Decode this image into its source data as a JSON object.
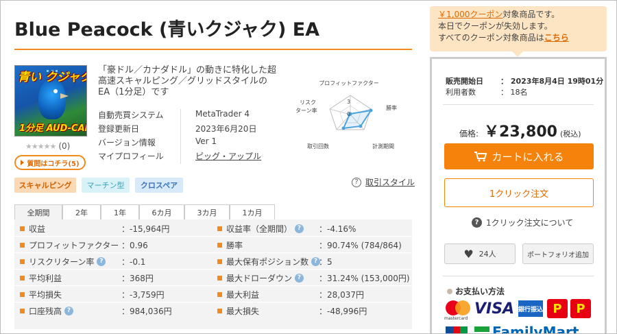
{
  "product": {
    "title": "Blue Peacock (青いクジャク) EA",
    "thumb_line1": "青い クジャク",
    "thumb_line2": "1分足  AUD-CAD",
    "stars": "★★★★★",
    "review_count": "(0)",
    "qa_label": "質問はコチラ(5)",
    "description": "「豪ドル／カナダドル」の動きに特化した超高速スキャルピング／グリッドスタイルのEA（1分足）です"
  },
  "specs": [
    {
      "key": "自動売買システム",
      "value": "MetaTrader 4"
    },
    {
      "key": "登録更新日",
      "value": "2023年6月20日"
    },
    {
      "key": "バージョン情報",
      "value": "Ver 1"
    },
    {
      "key": "マイプロフィール",
      "value": "ピッグ・アップル"
    }
  ],
  "radar": {
    "labels": {
      "pf": "プロフィットファクター",
      "winrate": "勝率",
      "period": "計測期間",
      "trades": "取引回数",
      "rr1": "リスク",
      "rr2": "ターン率"
    },
    "scale_max": "3",
    "scale_min": "0"
  },
  "tags": [
    "スキャルピング",
    "マーチン型",
    "クロスペア"
  ],
  "trade_style": {
    "icon": "?",
    "label": "取引スタイル"
  },
  "tabs": [
    "全期間",
    "2年",
    "1年",
    "6カ月",
    "3カ月",
    "1カ月"
  ],
  "stats_left": [
    {
      "label": "収益",
      "value": "：-15,964円",
      "help": false
    },
    {
      "label": "プロフィットファクター",
      "value": "：0.96",
      "help": false
    },
    {
      "label": "リスクリターン率",
      "value": "：-0.1",
      "help": true
    },
    {
      "label": "平均利益",
      "value": "：368円",
      "help": false
    },
    {
      "label": "平均損失",
      "value": "：-3,759円",
      "help": false
    },
    {
      "label": "口座残高",
      "value": "：984,036円",
      "help": true
    }
  ],
  "stats_right": [
    {
      "label": "収益率（全期間）",
      "value": "：-4.16%",
      "help": true
    },
    {
      "label": "勝率",
      "value": "：90.74% (784/864)",
      "help": false
    },
    {
      "label": "最大保有ポジション数",
      "value": "：5",
      "help": true
    },
    {
      "label": "最大ドローダウン",
      "value": "：31.24% (153,000円)",
      "help": true
    },
    {
      "label": "最大利益",
      "value": "：28,037円",
      "help": false
    },
    {
      "label": "最大損失",
      "value": "：-48,996円",
      "help": false
    }
  ],
  "coupon": {
    "line1_link": "￥1,000クーポン",
    "line1_rest": "対象商品です。",
    "line2": "本日でクーポンが失効します。",
    "line3_pre": "すべてのクーポン対象商品は",
    "line3_link": "こちら"
  },
  "sales": {
    "start_key": "販売開始日",
    "start_val": "：  2023年8月4日 19時01分",
    "users_key": "利用者数",
    "users_val": "：  18名",
    "price_label": "価格:",
    "price": "￥23,800",
    "tax": "(税込)",
    "cart_label": "カートに入れる",
    "oneclick_label": "1クリック注文",
    "oneclick_help": "1クリック注文について",
    "fav_count": "24人",
    "portfolio_label": "ポートフォリオ追加",
    "payment_title": "お支払い方法"
  },
  "payment": {
    "mastercard_text": "mastercard",
    "visa": "VISA",
    "bank": "銀行振込",
    "dp1": "P",
    "dp2": "P",
    "familymart": "FamilyMart"
  },
  "colors": {
    "accent": "#f5820b",
    "stat_bullet": "#f08a1c",
    "radar_line": "#4aa3df"
  }
}
